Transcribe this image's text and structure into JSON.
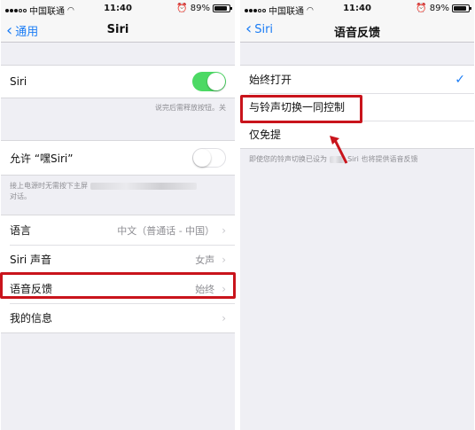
{
  "status": {
    "carrier": "中国联通",
    "time": "11:40",
    "battery": "89%",
    "battery_level": 0.89
  },
  "left": {
    "back_label": "通用",
    "title": "Siri",
    "siri_label": "Siri",
    "siri_on": true,
    "siri_footer": "说完后需释放按钮。关",
    "hey_siri_label": "允许 “嘿Siri”",
    "hey_siri_on": false,
    "hey_siri_footer_1": "接上电源时无需按下主屏",
    "hey_siri_footer_2": "对话。",
    "language_label": "语言",
    "language_value": "中文（普通话 - 中国）",
    "voice_label": "Siri 声音",
    "voice_value": "女声",
    "feedback_label": "语音反馈",
    "feedback_value": "始终",
    "myinfo_label": "我的信息"
  },
  "right": {
    "back_label": "Siri",
    "title": "语音反馈",
    "options": [
      {
        "label": "始终打开",
        "checked": true
      },
      {
        "label": "与铃声切换一同控制",
        "checked": false
      },
      {
        "label": "仅免提",
        "checked": false
      }
    ],
    "footer": "即使您的铃声切换已设为",
    "footer_2": "Siri 也将提供语音反馈"
  },
  "colors": {
    "accent": "#1a7cf5",
    "toggle_on": "#4cd964",
    "highlight": "#c9141c"
  }
}
